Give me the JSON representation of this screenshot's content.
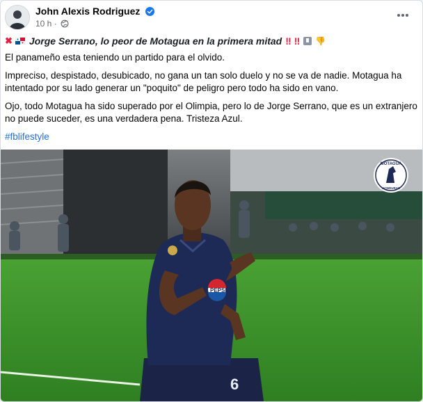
{
  "post": {
    "author": "John Alexis Rodriguez",
    "time": "10 h",
    "headline": "Jorge Serrano, lo peor de Motagua en la primera mitad",
    "paragraphs": [
      "El panameño esta teniendo un partido para el olvido.",
      "Impreciso, despistado, desubicado, no gana un tan solo duelo y no se va de nadie. Motagua ha intentado por su lado generar un \"poquito\" de peligro pero todo ha sido en vano.",
      "Ojo, todo Motagua ha sido superado por el Olimpia,  pero lo de Jorge Serrano, que es un extranjero no puede suceder, es una verdadera pena. Tristeza Azul."
    ],
    "hashtag": "#fblifestyle"
  },
  "photo": {
    "badge_top": "MOTAGUA",
    "badge_bottom": "HONDURAS",
    "shirt_sponsor": "PEPSI"
  },
  "icons": {
    "verified": "verified-icon",
    "audience": "globe-icon",
    "more": "more-options-icon"
  },
  "colors": {
    "link": "#216fdb",
    "verified": "#1877f2",
    "alert": "#e41e3f",
    "jersey": "#1d2a55",
    "pitch": "#3f9a2b"
  }
}
